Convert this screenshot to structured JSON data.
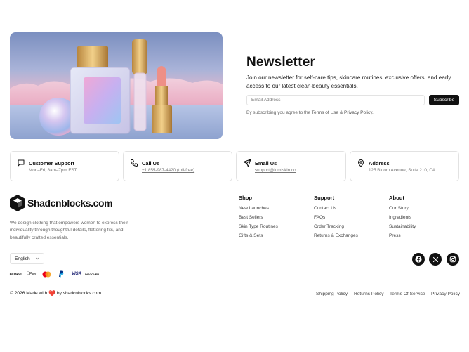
{
  "newsletter": {
    "title": "Newsletter",
    "description": "Join our newsletter for self-care tips, skincare routines, exclusive offers, and early access to our latest clean-beauty essentials.",
    "email_placeholder": "Email Address",
    "subscribe_label": "Subscribe",
    "note_prefix": "By subscribing you agree to the",
    "terms_label": "Terms of Use",
    "note_amp": "&",
    "privacy_label": "Privacy Policy",
    "note_suffix": "."
  },
  "contacts": [
    {
      "title": "Customer Support",
      "sub": "Mon–Fri, 8am–7pm EST.",
      "icon": "chat-icon"
    },
    {
      "title": "Call Us",
      "sub": "+1 855-987-4420 (toll-free)",
      "icon": "phone-icon"
    },
    {
      "title": "Email Us",
      "sub": "support@lumiskin.co",
      "icon": "send-icon"
    },
    {
      "title": "Address",
      "sub": "125 Bloom Avenue, Suite 210, CA",
      "icon": "map-pin-icon"
    }
  ],
  "brand": {
    "name": "Shadcnblocks.com",
    "description": "We design clothing that empowers women to express their individuality through thoughtful details, flattering fits, and beautifully crafted essentials."
  },
  "columns": [
    {
      "heading": "Shop",
      "links": [
        "New Launches",
        "Best Sellers",
        "Skin Type Routines",
        "Gifts & Sets"
      ]
    },
    {
      "heading": "Support",
      "links": [
        "Contact Us",
        "FAQs",
        "Order Tracking",
        "Returns & Exchanges"
      ]
    },
    {
      "heading": "About",
      "links": [
        "Our Story",
        "Ingredients",
        "Sustainability",
        "Press"
      ]
    }
  ],
  "language": {
    "selected": "English"
  },
  "payments": [
    "amazon",
    "Pay",
    "mastercard",
    "paypal",
    "VISA",
    "DISCOVER"
  ],
  "socials": [
    "facebook-icon",
    "x-icon",
    "instagram-icon"
  ],
  "copyright": {
    "prefix": "© 2026 Made with",
    "heart": "❤️",
    "suffix": "by shadcnblocks.com"
  },
  "legal": [
    "Shipping Policy",
    "Returns Policy",
    "Terms Of Service",
    "Privacy Policy"
  ],
  "colors": {
    "accent": "#111111",
    "heart": "#e63946",
    "mastercard_red": "#eb001b",
    "mastercard_orange": "#f79e1b",
    "visa": "#1a1f71",
    "paypal": "#003087"
  }
}
